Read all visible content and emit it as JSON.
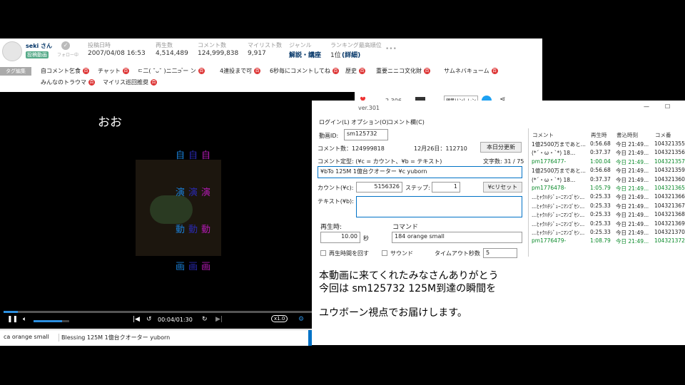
{
  "header": {
    "user": "seki さん",
    "user_badge": "投稿動画",
    "follow": "フォロー中",
    "stats": [
      {
        "label": "投稿日時",
        "value": "2007/04/08 16:53"
      },
      {
        "label": "再生数",
        "value": "4,514,489"
      },
      {
        "label": "コメント数",
        "value": "124,999,838"
      },
      {
        "label": "マイリスト数",
        "value": "9,917"
      },
      {
        "label": "ジャンル",
        "value": "解説・講座"
      },
      {
        "label": "ランキング最高順位",
        "value": "1位",
        "extra": "(詳細)"
      }
    ],
    "more": "•••"
  },
  "tags": {
    "edit": "タグ編集",
    "row1": [
      "自コメント乞食",
      "チャット",
      "ㄷ二( ˘ᴗ˘ )ニ二ᴝ ゚ー ン",
      "4連投まで可",
      "6秒毎にコメントしてね",
      "歴史",
      "重要ニニコ文化財",
      "サムネバキューム"
    ],
    "row2": [
      "みんなのトラウマ",
      "マイリス巡回推奨"
    ],
    "badge": "百"
  },
  "share_bar": {
    "likes": "2,306",
    "button": "領音リンしレン"
  },
  "player": {
    "overlay_main": "おお",
    "overlay_cols": [
      {
        "c1": "自",
        "c2": "自",
        "c3": "自"
      },
      {
        "c1": "演",
        "c2": "演",
        "c3": "演"
      },
      {
        "c1": "動",
        "c2": "動",
        "c3": "動"
      },
      {
        "c1": "画",
        "c2": "画",
        "c3": "画"
      }
    ],
    "time": "00:04/01:30",
    "speed": "x1.0",
    "progress": 0.04,
    "volume": 0.8,
    "comment_cmd": "ca orange small",
    "comment_text": "Blessing 125M 1億台クオーター yuborn"
  },
  "tool": {
    "title": "ver.301",
    "menu": [
      "ログイン(L)",
      "オプション(O)",
      "コメント欄(C)"
    ],
    "video_id_label": "動画ID:",
    "video_id": "sm125732",
    "comment_count": "コメント数：124999818",
    "date": "12月26日：112710",
    "update_btn": "本日分更新",
    "template_label": "コメント定型: (¥c = カウント、¥b = テキスト)",
    "char_count": "文字数: 31 / 75",
    "template_value": "¥bTo 125M 1億台クオーター ¥c yuborn",
    "count_label": "カウント(¥c):",
    "count_value": "5156326",
    "step_label": "ステップ:",
    "step_value": "1",
    "reset_btn": "¥cリセット",
    "text_label": "テキスト(¥b):",
    "play_label": "再生時:",
    "command_label": "コマンド",
    "play_value": "10.00",
    "sec": "秒",
    "command_value": "184 orange small",
    "loop_label": "再生時間を回す",
    "sound_label": "サウンド",
    "timeout_label": "タイムアウト秒数",
    "timeout_value": "5",
    "grid_headers": [
      "コメント",
      "再生時",
      "書込時刻",
      "コメ番"
    ],
    "grid_rows": [
      {
        "c": "1億2500万まであと...",
        "t": "0:56.68",
        "w": "今日 21:49...",
        "n": "104321355",
        "g": false
      },
      {
        "c": "(*´・ω・`*) 18...",
        "t": "0:37.37",
        "w": "今日 21:49...",
        "n": "104321356",
        "g": false
      },
      {
        "c": "pm1776477-",
        "t": "1:00.04",
        "w": "今日 21:49...",
        "n": "104321357",
        "g": true
      },
      {
        "c": "1億2500万まであと...",
        "t": "0:56.68",
        "w": "今日 21:49...",
        "n": "104321359",
        "g": false
      },
      {
        "c": "(*´・ω・`*) 18...",
        "t": "0:37.37",
        "w": "今日 21:49...",
        "n": "104321360",
        "g": false
      },
      {
        "c": "pm1776478-",
        "t": "1:05.79",
        "w": "今日 21:49...",
        "n": "104321365",
        "g": true
      },
      {
        "c": "...ﾋｬｸﾊﾁｼﾞｭｰﾆﾏﾝｺﾞｾﾝ...",
        "t": "0:25.33",
        "w": "今日 21:49...",
        "n": "104321366",
        "g": false
      },
      {
        "c": "...ﾋｬｸﾊﾁｼﾞｭｰﾆﾏﾝｺﾞｾﾝ...",
        "t": "0:25.33",
        "w": "今日 21:49...",
        "n": "104321367",
        "g": false
      },
      {
        "c": "...ﾋｬｸﾊﾁｼﾞｭｰﾆﾏﾝｺﾞｾﾝ...",
        "t": "0:25.33",
        "w": "今日 21:49...",
        "n": "104321368",
        "g": false
      },
      {
        "c": "...ﾋｬｸﾊﾁｼﾞｭｰﾆﾏﾝｺﾞｾﾝ...",
        "t": "0:25.33",
        "w": "今日 21:49...",
        "n": "104321369",
        "g": false
      },
      {
        "c": "...ﾋｬｸﾊﾁｼﾞｭｰﾆﾏﾝｺﾞｾﾝ...",
        "t": "0:25.33",
        "w": "今日 21:49...",
        "n": "104321370",
        "g": false
      },
      {
        "c": "pm1776479-",
        "t": "1:08.79",
        "w": "今日 21:49...",
        "n": "104321372",
        "g": true
      }
    ]
  },
  "caption": {
    "line1": "本動画に来てくれたみなさんありがとう",
    "line2": "今回は sm125732 125M到達の瞬間を",
    "line3": "ユウボーン視点でお届けします。"
  },
  "colors": {
    "accent": "#0072c6",
    "tag_badge": "#d33333",
    "green": "#0a8a2a",
    "overlay_c1": "#1a7fd6",
    "overlay_c2": "#2a2ab0",
    "overlay_c3": "#b01ab0"
  }
}
